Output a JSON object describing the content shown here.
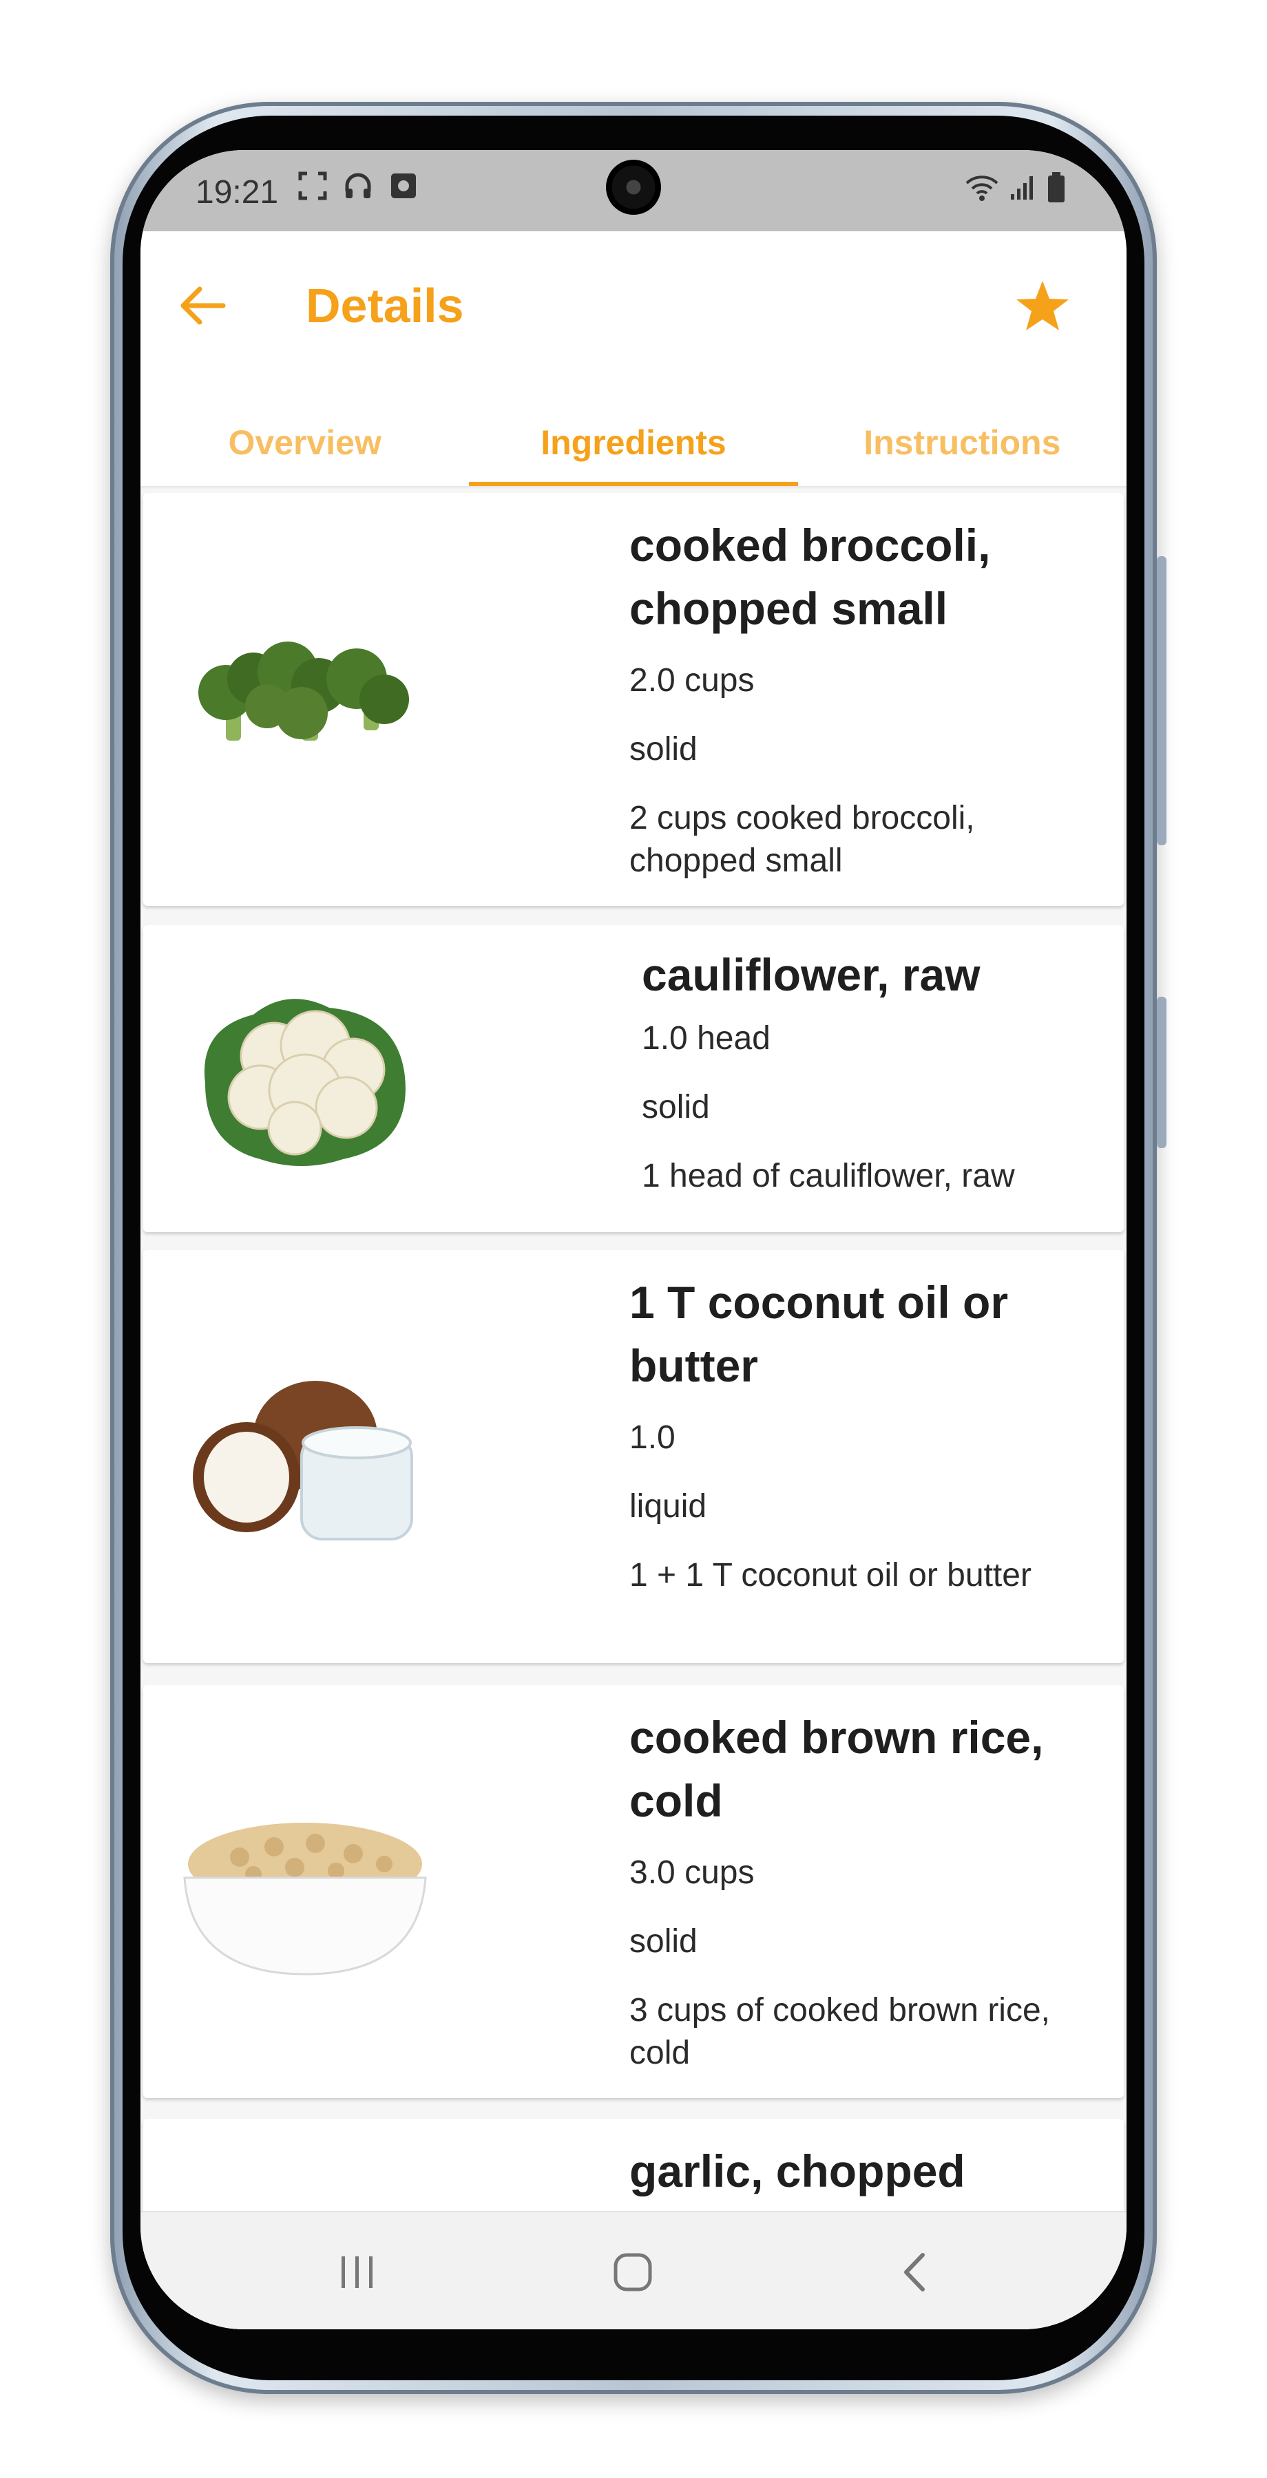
{
  "colors": {
    "accent": "#f5a11a",
    "accent_light": "#f8be62"
  },
  "status_bar": {
    "time": "19:21",
    "left_icons": [
      "screenshot-icon",
      "headphones-icon",
      "record-icon"
    ],
    "right_icons": [
      "wifi-icon",
      "signal-icon",
      "battery-icon"
    ]
  },
  "header": {
    "back_icon": "arrow-left-icon",
    "title": "Details",
    "favorite_icon": "star-icon"
  },
  "tabs": [
    {
      "label": "Overview",
      "active": false
    },
    {
      "label": "Ingredients",
      "active": true
    },
    {
      "label": "Instructions",
      "active": false
    }
  ],
  "ingredients": [
    {
      "name": "cooked broccoli, chopped small",
      "quantity": "2.0 cups",
      "state": "solid",
      "description": "2 cups cooked broccoli, chopped small",
      "image": "broccoli-image"
    },
    {
      "name": "cauliflower, raw",
      "quantity": "1.0 head",
      "state": "solid",
      "description": "1 head of cauliflower, raw",
      "image": "cauliflower-image"
    },
    {
      "name": "1 T coconut oil or butter",
      "quantity": "1.0",
      "state": "liquid",
      "description": "1 + 1 T coconut oil or butter",
      "image": "coconut-oil-image"
    },
    {
      "name": "cooked brown rice, cold",
      "quantity": "3.0 cups",
      "state": "solid",
      "description": "3 cups of cooked brown rice, cold",
      "image": "brown-rice-image"
    },
    {
      "name": "garlic, chopped",
      "image": "garlic-image"
    }
  ],
  "nav_bar": {
    "icons": [
      "recent-apps-icon",
      "home-icon",
      "back-icon"
    ]
  }
}
